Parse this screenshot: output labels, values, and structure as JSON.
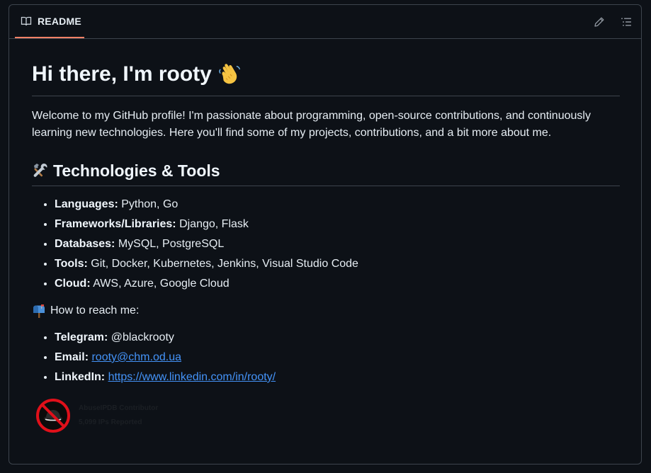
{
  "header": {
    "tab_label": "README",
    "icons": {
      "book": "book-icon",
      "edit": "pencil-icon",
      "outline": "list-icon"
    }
  },
  "readme": {
    "title": "Hi there, I'm rooty",
    "title_emoji": "waving-hand-icon",
    "intro": "Welcome to my GitHub profile! I'm passionate about programming, open-source contributions, and continuously learning new technologies. Here you'll find some of my projects, contributions, and a bit more about me.",
    "tech_heading": "Technologies & Tools",
    "tech_emoji": "hammer-wrench-icon",
    "tech_items": [
      {
        "label": "Languages:",
        "value": " Python, Go"
      },
      {
        "label": "Frameworks/Libraries:",
        "value": " Django, Flask"
      },
      {
        "label": "Databases:",
        "value": " MySQL, PostgreSQL"
      },
      {
        "label": "Tools:",
        "value": " Git, Docker, Kubernetes, Jenkins, Visual Studio Code"
      },
      {
        "label": "Cloud:",
        "value": " AWS, Azure, Google Cloud"
      }
    ],
    "reach_text": "How to reach me:",
    "reach_emoji": "mailbox-icon",
    "contacts": {
      "telegram_label": "Telegram:",
      "telegram_value": " @blackrooty",
      "email_label": "Email:",
      "email_value": "rooty@chm.od.ua",
      "linkedin_label": "LinkedIn:",
      "linkedin_value": "https://www.linkedin.com/in/rooty/"
    },
    "badge": {
      "line1": "AbuseIPDB Contributor",
      "line2": "5,099 IPs Reported"
    }
  },
  "colors": {
    "background": "#0d1117",
    "border": "#3d444d",
    "text": "#e6edf3",
    "link": "#4493f8",
    "tab_underline": "#f78166"
  }
}
